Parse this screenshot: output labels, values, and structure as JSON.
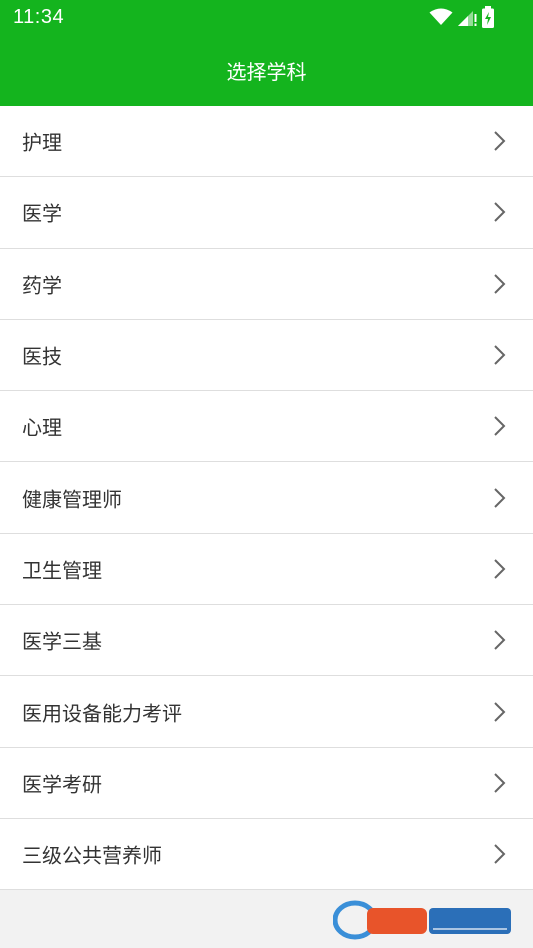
{
  "status_bar": {
    "time": "11:34",
    "icons": [
      "wifi-icon",
      "signal-icon",
      "battery-charging-icon"
    ]
  },
  "header": {
    "title": "选择学科"
  },
  "subjects": [
    {
      "label": "护理"
    },
    {
      "label": "医学"
    },
    {
      "label": "药学"
    },
    {
      "label": "医技"
    },
    {
      "label": "心理"
    },
    {
      "label": "健康管理师"
    },
    {
      "label": "卫生管理"
    },
    {
      "label": "医学三基"
    },
    {
      "label": "医用设备能力考评"
    },
    {
      "label": "医学考研"
    },
    {
      "label": "三级公共营养师"
    }
  ],
  "colors": {
    "header_bg": "#14b41e",
    "text": "#333333",
    "chevron": "#666666",
    "divider": "#dedede"
  }
}
